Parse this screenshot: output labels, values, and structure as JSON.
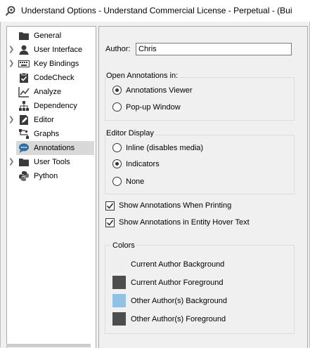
{
  "window": {
    "title": "Understand Options - Understand Commercial License - Perpetual - (Bui"
  },
  "tree": {
    "items": [
      {
        "label": "General",
        "icon": "folder-icon",
        "expandable": false
      },
      {
        "label": "User Interface",
        "icon": "user-icon",
        "expandable": true
      },
      {
        "label": "Key Bindings",
        "icon": "keyboard-icon",
        "expandable": true
      },
      {
        "label": "CodeCheck",
        "icon": "clipboard-check-icon",
        "expandable": false
      },
      {
        "label": "Analyze",
        "icon": "chart-icon",
        "expandable": false
      },
      {
        "label": "Dependency",
        "icon": "hierarchy-icon",
        "expandable": false
      },
      {
        "label": "Editor",
        "icon": "document-edit-icon",
        "expandable": true
      },
      {
        "label": "Graphs",
        "icon": "graph-icon",
        "expandable": false
      },
      {
        "label": "Annotations",
        "icon": "speech-bubble-icon",
        "expandable": false,
        "selected": true
      },
      {
        "label": "User Tools",
        "icon": "folder-icon",
        "expandable": true
      },
      {
        "label": "Python",
        "icon": "python-icon",
        "expandable": false
      }
    ]
  },
  "author": {
    "label": "Author:",
    "value": "Chris"
  },
  "open_annotations": {
    "title": "Open Annotations in:",
    "options": [
      "Annotations Viewer",
      "Pop-up Window"
    ],
    "selected": "Annotations Viewer"
  },
  "editor_display": {
    "title": "Editor Display",
    "options": [
      "Inline (disables media)",
      "Indicators",
      "None"
    ],
    "selected": "Indicators"
  },
  "checkboxes": [
    {
      "label": "Show Annotations When Printing",
      "checked": true
    },
    {
      "label": "Show Annotations in Entity Hover Text",
      "checked": true
    }
  ],
  "colors": {
    "title": "Colors",
    "items": [
      {
        "label": "Current Author Background",
        "color": "#f0f0f0"
      },
      {
        "label": "Current Author Foreground",
        "color": "#4d4d4d"
      },
      {
        "label": "Other Author(s) Background",
        "color": "#8fc2e6"
      },
      {
        "label": "Other Author(s) Foreground",
        "color": "#4d4d4d"
      }
    ]
  }
}
